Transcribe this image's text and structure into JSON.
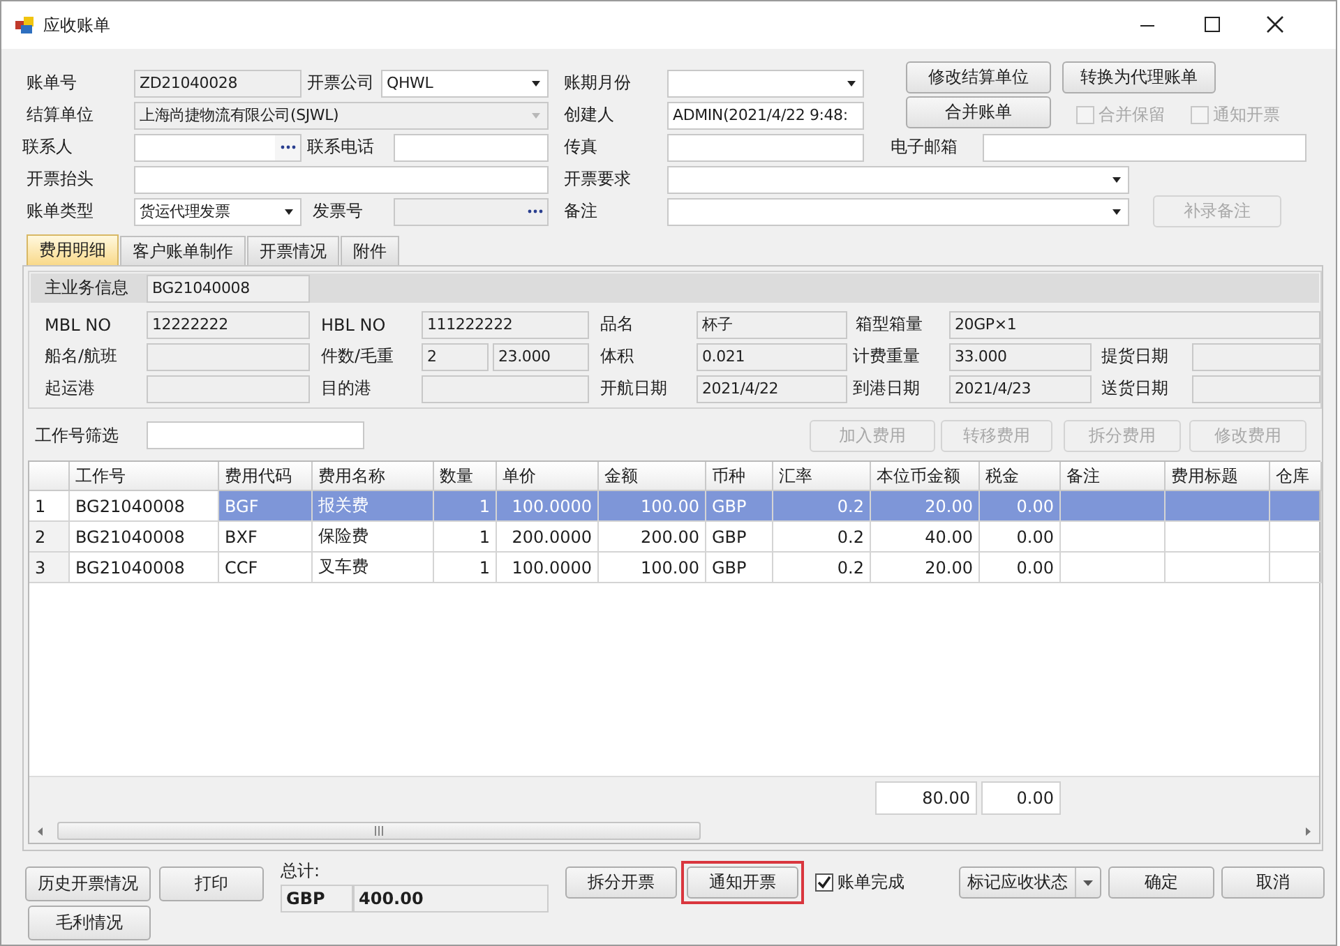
{
  "window": {
    "title": "应收账单"
  },
  "form": {
    "rows": [
      {
        "items": [
          {
            "kind": "label",
            "text": "账单号"
          },
          {
            "kind": "text",
            "value": "ZD21040028",
            "disabled": true
          },
          {
            "kind": "label",
            "text": "开票公司"
          },
          {
            "kind": "combo",
            "value": "QHWL",
            "disabled": false
          },
          {
            "kind": "label",
            "text": "账期月份"
          },
          {
            "kind": "combo",
            "disabled": false
          },
          {
            "kind": "button",
            "text": "修改结算单位",
            "disabled": false
          },
          {
            "kind": "button",
            "text": "转换为代理账单",
            "disabled": false
          }
        ]
      },
      {
        "items": [
          {
            "kind": "label",
            "text": "结算单位"
          },
          {
            "kind": "combo",
            "value": "上海尚捷物流有限公司(SJWL)",
            "disabled": true
          },
          {
            "kind": "label",
            "text": "创建人"
          },
          {
            "kind": "text",
            "value": "ADMIN(2021/4/22 9:48:",
            "disabled": false
          },
          {
            "kind": "button",
            "text": "合并账单",
            "disabled": false
          },
          {
            "kind": "check",
            "text": "合并保留",
            "checked": false,
            "disabled": true
          },
          {
            "kind": "check",
            "text": "通知开票",
            "checked": false,
            "disabled": true
          }
        ]
      },
      {
        "items": [
          {
            "kind": "label",
            "text": "联系人"
          },
          {
            "kind": "lookup",
            "disabled": false
          },
          {
            "kind": "label",
            "text": "联系电话"
          },
          {
            "kind": "text",
            "disabled": false
          },
          {
            "kind": "label",
            "text": "传真"
          },
          {
            "kind": "text",
            "disabled": false
          },
          {
            "kind": "label",
            "text": "电子邮箱"
          },
          {
            "kind": "text",
            "disabled": false
          }
        ]
      },
      {
        "items": [
          {
            "kind": "label",
            "text": "开票抬头"
          },
          {
            "kind": "text",
            "disabled": false
          },
          {
            "kind": "label",
            "text": "开票要求"
          },
          {
            "kind": "combo",
            "disabled": false
          }
        ]
      },
      {
        "items": [
          {
            "kind": "label",
            "text": "账单类型"
          },
          {
            "kind": "combo",
            "value": "货运代理发票",
            "disabled": false
          },
          {
            "kind": "label",
            "text": "发票号"
          },
          {
            "kind": "lookup",
            "disabled": true
          },
          {
            "kind": "label",
            "text": "备注"
          },
          {
            "kind": "combo",
            "disabled": false
          },
          {
            "kind": "button",
            "text": "补录备注",
            "disabled": true
          }
        ]
      }
    ]
  },
  "tabs": [
    {
      "label": "费用明细",
      "selected": true
    },
    {
      "label": "客户账单制作",
      "selected": false
    },
    {
      "label": "开票情况",
      "selected": false
    },
    {
      "label": "附件",
      "selected": false
    }
  ],
  "business_info": {
    "label": "主业务信息",
    "value": "BG21040008",
    "rows": [
      {
        "items": [
          {
            "kind": "label",
            "text": "MBL NO"
          },
          {
            "kind": "text",
            "value": "12222222"
          },
          {
            "kind": "label",
            "text": "HBL NO"
          },
          {
            "kind": "text",
            "value": "111222222"
          },
          {
            "kind": "label",
            "text": "品名"
          },
          {
            "kind": "text",
            "value": "杯子"
          },
          {
            "kind": "label",
            "text": "箱型箱量"
          },
          {
            "kind": "text",
            "value": "20GP×1"
          }
        ]
      },
      {
        "items": [
          {
            "kind": "label",
            "text": "船名/航班"
          },
          {
            "kind": "text"
          },
          {
            "kind": "label",
            "text": "件数/毛重"
          },
          {
            "kind": "text",
            "value": "2"
          },
          {
            "kind": "text",
            "value": "23.000"
          },
          {
            "kind": "label",
            "text": "体积"
          },
          {
            "kind": "text",
            "value": "0.021"
          },
          {
            "kind": "label",
            "text": "计费重量"
          },
          {
            "kind": "text",
            "value": "33.000"
          },
          {
            "kind": "label",
            "text": "提货日期"
          },
          {
            "kind": "text"
          }
        ]
      },
      {
        "items": [
          {
            "kind": "label",
            "text": "起运港"
          },
          {
            "kind": "text"
          },
          {
            "kind": "label",
            "text": "目的港"
          },
          {
            "kind": "text"
          },
          {
            "kind": "label",
            "text": "开航日期"
          },
          {
            "kind": "text",
            "value": "2021/4/22"
          },
          {
            "kind": "label",
            "text": "到港日期"
          },
          {
            "kind": "text",
            "value": "2021/4/23"
          },
          {
            "kind": "label",
            "text": "送货日期"
          },
          {
            "kind": "text"
          }
        ]
      }
    ]
  },
  "filter": {
    "label": "工作号筛选",
    "buttons": [
      {
        "label": "加入费用",
        "disabled": true
      },
      {
        "label": "转移费用",
        "disabled": true
      },
      {
        "label": "拆分费用",
        "disabled": true
      },
      {
        "label": "修改费用",
        "disabled": true
      }
    ]
  },
  "table": {
    "columns": [
      "工作号",
      "费用代码",
      "费用名称",
      "数量",
      "单价",
      "金额",
      "币种",
      "汇率",
      "本位币金额",
      "税金",
      "备注",
      "费用标题",
      "仓库"
    ],
    "rows": [
      {
        "row_number": "1",
        "selected": true,
        "cells": [
          "BG21040008",
          "BGF",
          "报关费",
          "1",
          "100.0000",
          "100.00",
          "GBP",
          "0.2",
          "20.00",
          "0.00",
          "",
          "",
          ""
        ]
      },
      {
        "row_number": "2",
        "selected": false,
        "cells": [
          "BG21040008",
          "BXF",
          "保险费",
          "1",
          "200.0000",
          "200.00",
          "GBP",
          "0.2",
          "40.00",
          "0.00",
          "",
          "",
          ""
        ]
      },
      {
        "row_number": "3",
        "selected": false,
        "cells": [
          "BG21040008",
          "CCF",
          "叉车费",
          "1",
          "100.0000",
          "100.00",
          "GBP",
          "0.2",
          "20.00",
          "0.00",
          "",
          "",
          ""
        ]
      }
    ],
    "totals": [
      "80.00",
      "0.00"
    ]
  },
  "bottom": {
    "left_buttons": [
      "历史开票情况",
      "打印",
      "毛利情况"
    ],
    "total": {
      "label": "总计:",
      "currency": "GBP",
      "amount": "400.00"
    },
    "actions": [
      {
        "kind": "button",
        "label": "拆分开票"
      },
      {
        "kind": "button",
        "label": "通知开票",
        "highlighted": true
      },
      {
        "kind": "check",
        "label": "账单完成",
        "checked": true
      },
      {
        "kind": "split",
        "label": "标记应收状态"
      },
      {
        "kind": "button",
        "label": "确定"
      },
      {
        "kind": "button",
        "label": "取消"
      }
    ]
  }
}
